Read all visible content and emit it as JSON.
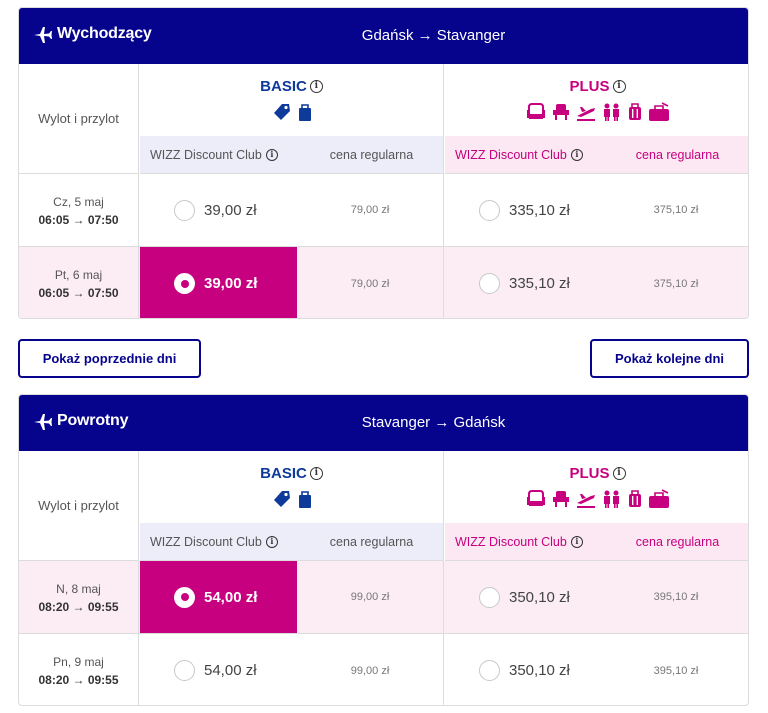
{
  "colors": {
    "brand_navy": "#06038d",
    "accent_magenta": "#c6007e",
    "basic_blue": "#0e3a9a",
    "basic_bg": "#ededfa",
    "plus_bg": "#fce8f3"
  },
  "outbound": {
    "title": "Wychodzący",
    "route": "Gdańsk → Stavanger",
    "label_column": "Wylot i przylot",
    "basic": {
      "name": "BASIC",
      "icons": [
        "price-tag-icon",
        "small-bag-icon"
      ]
    },
    "plus": {
      "name": "PLUS",
      "icons": [
        "seat-icon",
        "seat-selection-icon",
        "priority-boarding-icon",
        "check-in-icon",
        "trolley-bag-icon",
        "checked-bag-icon"
      ]
    },
    "subheaders": {
      "club": "WIZZ Discount Club",
      "regular": "cena regularna"
    },
    "rows": [
      {
        "day": "Cz, 5 maj",
        "times": "06:05 → 07:50",
        "basic_club": "39,00 zł",
        "basic_regular": "79,00 zł",
        "plus_club": "335,10 zł",
        "plus_regular": "375,10 zł",
        "selected": "none"
      },
      {
        "day": "Pt, 6 maj",
        "times": "06:05 → 07:50",
        "basic_club": "39,00 zł",
        "basic_regular": "79,00 zł",
        "plus_club": "335,10 zł",
        "plus_regular": "375,10 zł",
        "selected": "basic_club"
      }
    ]
  },
  "nav": {
    "prev_label": "Pokaż poprzednie dni",
    "next_label": "Pokaż kolejne dni"
  },
  "return": {
    "title": "Powrotny",
    "route": "Stavanger → Gdańsk",
    "label_column": "Wylot i przylot",
    "basic": {
      "name": "BASIC",
      "icons": [
        "price-tag-icon",
        "small-bag-icon"
      ]
    },
    "plus": {
      "name": "PLUS",
      "icons": [
        "seat-icon",
        "seat-selection-icon",
        "priority-boarding-icon",
        "check-in-icon",
        "trolley-bag-icon",
        "checked-bag-icon"
      ]
    },
    "subheaders": {
      "club": "WIZZ Discount Club",
      "regular": "cena regularna"
    },
    "rows": [
      {
        "day": "N, 8 maj",
        "times": "08:20 → 09:55",
        "basic_club": "54,00 zł",
        "basic_regular": "99,00 zł",
        "plus_club": "350,10 zł",
        "plus_regular": "395,10 zł",
        "selected": "basic_club"
      },
      {
        "day": "Pn, 9 maj",
        "times": "08:20 → 09:55",
        "basic_club": "54,00 zł",
        "basic_regular": "99,00 zł",
        "plus_club": "350,10 zł",
        "plus_regular": "395,10 zł",
        "selected": "none"
      }
    ]
  }
}
